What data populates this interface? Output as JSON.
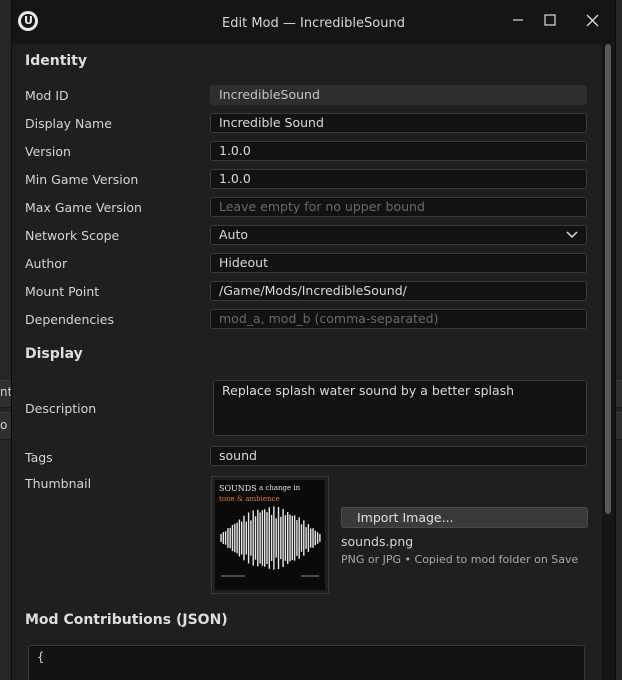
{
  "background": {
    "label1": "nt",
    "label2": "o"
  },
  "window": {
    "title": "Edit Mod — IncredibleSound",
    "logo_glyph": "U"
  },
  "identity": {
    "heading": "Identity",
    "fields": [
      {
        "label": "Mod ID",
        "value": "IncredibleSound",
        "placeholder": ""
      },
      {
        "label": "Display Name",
        "value": "Incredible Sound",
        "placeholder": ""
      },
      {
        "label": "Version",
        "value": "1.0.0",
        "placeholder": ""
      },
      {
        "label": "Min Game Version",
        "value": "1.0.0",
        "placeholder": ""
      },
      {
        "label": "Max Game Version",
        "value": "",
        "placeholder": "Leave empty for no upper bound"
      },
      {
        "label": "Network Scope",
        "value": "Auto",
        "placeholder": ""
      },
      {
        "label": "Author",
        "value": "Hideout",
        "placeholder": ""
      },
      {
        "label": "Mount Point",
        "value": "/Game/Mods/IncredibleSound/",
        "placeholder": ""
      },
      {
        "label": "Dependencies",
        "value": "",
        "placeholder": "mod_a, mod_b  (comma-separated)"
      }
    ]
  },
  "display": {
    "heading": "Display",
    "description_label": "Description",
    "description_value": "Replace splash water sound by a better splash",
    "tags_label": "Tags",
    "tags_value": "sound",
    "thumbnail_label": "Thumbnail",
    "thumbnail_text_1": "SOUNDS",
    "thumbnail_text_2": "a change in",
    "thumbnail_text_3": "tone & ambience",
    "import_button": "Import Image...",
    "file_name": "sounds.png",
    "file_hint": "PNG or JPG • Copied to mod folder on Save"
  },
  "contributions": {
    "heading": "Mod Contributions (JSON)",
    "json_text": "{"
  },
  "icons": {
    "minimize": "minimize-icon",
    "maximize": "maximize-icon",
    "close": "close-icon",
    "dropdown": "chevron-down-icon"
  },
  "colors": {
    "thumbnail_accent": "#e07a3a",
    "window_bg": "#1f1f1f"
  }
}
